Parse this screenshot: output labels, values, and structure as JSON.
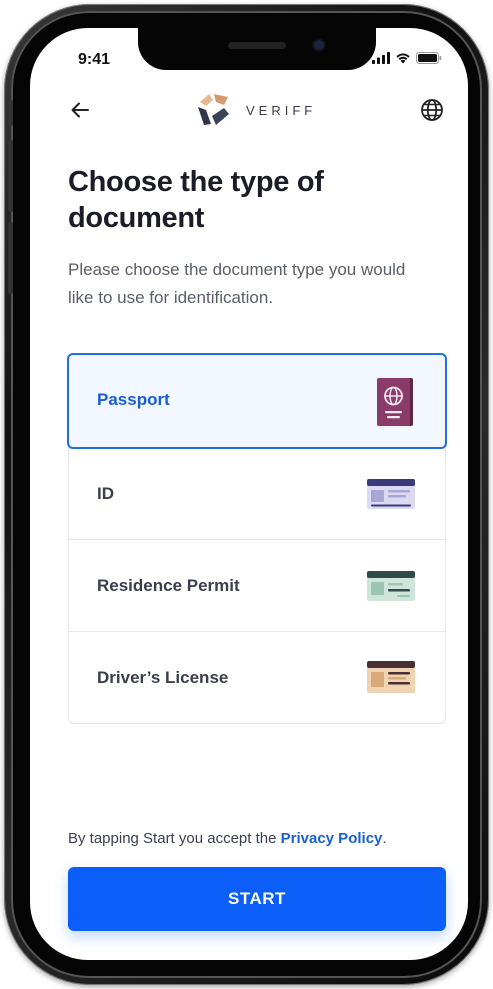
{
  "status_bar": {
    "time": "9:41",
    "icons": [
      "signal-icon",
      "wifi-icon",
      "battery-icon"
    ]
  },
  "header": {
    "back_icon": "arrow-left-icon",
    "logo_text": "VERIFF",
    "language_icon": "globe-icon"
  },
  "main": {
    "title": "Choose the type of document",
    "subtitle": "Please choose the document type you would like to use for identification.",
    "documents": [
      {
        "label": "Passport",
        "selected": true,
        "icon": "passport-icon"
      },
      {
        "label": "ID",
        "selected": false,
        "icon": "id-card-icon"
      },
      {
        "label": "Residence Permit",
        "selected": false,
        "icon": "residence-permit-icon"
      },
      {
        "label": "Driver’s License",
        "selected": false,
        "icon": "drivers-license-icon"
      }
    ]
  },
  "footer": {
    "privacy_prefix": "By tapping Start you accept the ",
    "privacy_link": "Privacy Policy",
    "privacy_suffix": ".",
    "start_label": "START"
  },
  "colors": {
    "accent": "#0b5ef7",
    "selected_border": "#1f6fe0",
    "selected_bg": "#f3f7ff",
    "title": "#1c1c28",
    "body": "#5a5d6b"
  }
}
